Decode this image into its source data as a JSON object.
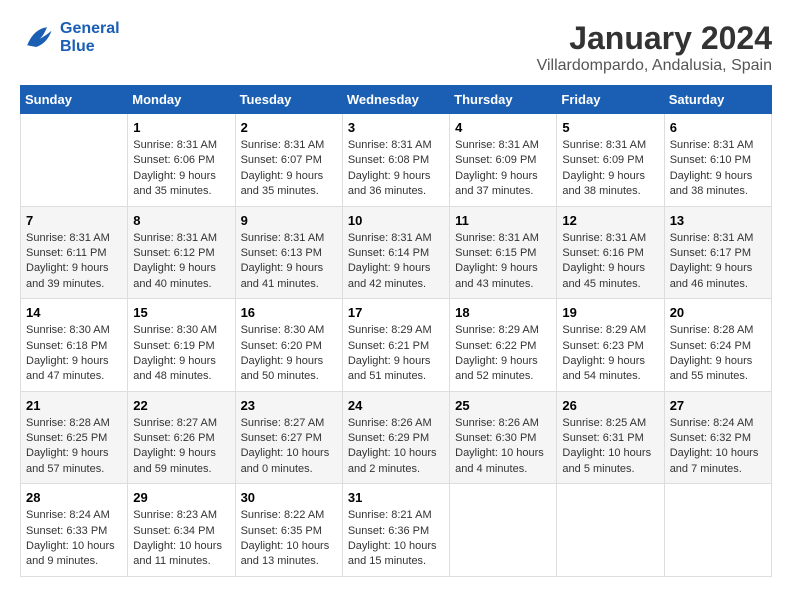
{
  "header": {
    "logo_line1": "General",
    "logo_line2": "Blue",
    "month": "January 2024",
    "location": "Villardompardo, Andalusia, Spain"
  },
  "weekdays": [
    "Sunday",
    "Monday",
    "Tuesday",
    "Wednesday",
    "Thursday",
    "Friday",
    "Saturday"
  ],
  "weeks": [
    [
      {
        "day": "",
        "sunrise": "",
        "sunset": "",
        "daylight": ""
      },
      {
        "day": "1",
        "sunrise": "Sunrise: 8:31 AM",
        "sunset": "Sunset: 6:06 PM",
        "daylight": "Daylight: 9 hours and 35 minutes."
      },
      {
        "day": "2",
        "sunrise": "Sunrise: 8:31 AM",
        "sunset": "Sunset: 6:07 PM",
        "daylight": "Daylight: 9 hours and 35 minutes."
      },
      {
        "day": "3",
        "sunrise": "Sunrise: 8:31 AM",
        "sunset": "Sunset: 6:08 PM",
        "daylight": "Daylight: 9 hours and 36 minutes."
      },
      {
        "day": "4",
        "sunrise": "Sunrise: 8:31 AM",
        "sunset": "Sunset: 6:09 PM",
        "daylight": "Daylight: 9 hours and 37 minutes."
      },
      {
        "day": "5",
        "sunrise": "Sunrise: 8:31 AM",
        "sunset": "Sunset: 6:09 PM",
        "daylight": "Daylight: 9 hours and 38 minutes."
      },
      {
        "day": "6",
        "sunrise": "Sunrise: 8:31 AM",
        "sunset": "Sunset: 6:10 PM",
        "daylight": "Daylight: 9 hours and 38 minutes."
      }
    ],
    [
      {
        "day": "7",
        "sunrise": "Sunrise: 8:31 AM",
        "sunset": "Sunset: 6:11 PM",
        "daylight": "Daylight: 9 hours and 39 minutes."
      },
      {
        "day": "8",
        "sunrise": "Sunrise: 8:31 AM",
        "sunset": "Sunset: 6:12 PM",
        "daylight": "Daylight: 9 hours and 40 minutes."
      },
      {
        "day": "9",
        "sunrise": "Sunrise: 8:31 AM",
        "sunset": "Sunset: 6:13 PM",
        "daylight": "Daylight: 9 hours and 41 minutes."
      },
      {
        "day": "10",
        "sunrise": "Sunrise: 8:31 AM",
        "sunset": "Sunset: 6:14 PM",
        "daylight": "Daylight: 9 hours and 42 minutes."
      },
      {
        "day": "11",
        "sunrise": "Sunrise: 8:31 AM",
        "sunset": "Sunset: 6:15 PM",
        "daylight": "Daylight: 9 hours and 43 minutes."
      },
      {
        "day": "12",
        "sunrise": "Sunrise: 8:31 AM",
        "sunset": "Sunset: 6:16 PM",
        "daylight": "Daylight: 9 hours and 45 minutes."
      },
      {
        "day": "13",
        "sunrise": "Sunrise: 8:31 AM",
        "sunset": "Sunset: 6:17 PM",
        "daylight": "Daylight: 9 hours and 46 minutes."
      }
    ],
    [
      {
        "day": "14",
        "sunrise": "Sunrise: 8:30 AM",
        "sunset": "Sunset: 6:18 PM",
        "daylight": "Daylight: 9 hours and 47 minutes."
      },
      {
        "day": "15",
        "sunrise": "Sunrise: 8:30 AM",
        "sunset": "Sunset: 6:19 PM",
        "daylight": "Daylight: 9 hours and 48 minutes."
      },
      {
        "day": "16",
        "sunrise": "Sunrise: 8:30 AM",
        "sunset": "Sunset: 6:20 PM",
        "daylight": "Daylight: 9 hours and 50 minutes."
      },
      {
        "day": "17",
        "sunrise": "Sunrise: 8:29 AM",
        "sunset": "Sunset: 6:21 PM",
        "daylight": "Daylight: 9 hours and 51 minutes."
      },
      {
        "day": "18",
        "sunrise": "Sunrise: 8:29 AM",
        "sunset": "Sunset: 6:22 PM",
        "daylight": "Daylight: 9 hours and 52 minutes."
      },
      {
        "day": "19",
        "sunrise": "Sunrise: 8:29 AM",
        "sunset": "Sunset: 6:23 PM",
        "daylight": "Daylight: 9 hours and 54 minutes."
      },
      {
        "day": "20",
        "sunrise": "Sunrise: 8:28 AM",
        "sunset": "Sunset: 6:24 PM",
        "daylight": "Daylight: 9 hours and 55 minutes."
      }
    ],
    [
      {
        "day": "21",
        "sunrise": "Sunrise: 8:28 AM",
        "sunset": "Sunset: 6:25 PM",
        "daylight": "Daylight: 9 hours and 57 minutes."
      },
      {
        "day": "22",
        "sunrise": "Sunrise: 8:27 AM",
        "sunset": "Sunset: 6:26 PM",
        "daylight": "Daylight: 9 hours and 59 minutes."
      },
      {
        "day": "23",
        "sunrise": "Sunrise: 8:27 AM",
        "sunset": "Sunset: 6:27 PM",
        "daylight": "Daylight: 10 hours and 0 minutes."
      },
      {
        "day": "24",
        "sunrise": "Sunrise: 8:26 AM",
        "sunset": "Sunset: 6:29 PM",
        "daylight": "Daylight: 10 hours and 2 minutes."
      },
      {
        "day": "25",
        "sunrise": "Sunrise: 8:26 AM",
        "sunset": "Sunset: 6:30 PM",
        "daylight": "Daylight: 10 hours and 4 minutes."
      },
      {
        "day": "26",
        "sunrise": "Sunrise: 8:25 AM",
        "sunset": "Sunset: 6:31 PM",
        "daylight": "Daylight: 10 hours and 5 minutes."
      },
      {
        "day": "27",
        "sunrise": "Sunrise: 8:24 AM",
        "sunset": "Sunset: 6:32 PM",
        "daylight": "Daylight: 10 hours and 7 minutes."
      }
    ],
    [
      {
        "day": "28",
        "sunrise": "Sunrise: 8:24 AM",
        "sunset": "Sunset: 6:33 PM",
        "daylight": "Daylight: 10 hours and 9 minutes."
      },
      {
        "day": "29",
        "sunrise": "Sunrise: 8:23 AM",
        "sunset": "Sunset: 6:34 PM",
        "daylight": "Daylight: 10 hours and 11 minutes."
      },
      {
        "day": "30",
        "sunrise": "Sunrise: 8:22 AM",
        "sunset": "Sunset: 6:35 PM",
        "daylight": "Daylight: 10 hours and 13 minutes."
      },
      {
        "day": "31",
        "sunrise": "Sunrise: 8:21 AM",
        "sunset": "Sunset: 6:36 PM",
        "daylight": "Daylight: 10 hours and 15 minutes."
      },
      {
        "day": "",
        "sunrise": "",
        "sunset": "",
        "daylight": ""
      },
      {
        "day": "",
        "sunrise": "",
        "sunset": "",
        "daylight": ""
      },
      {
        "day": "",
        "sunrise": "",
        "sunset": "",
        "daylight": ""
      }
    ]
  ]
}
